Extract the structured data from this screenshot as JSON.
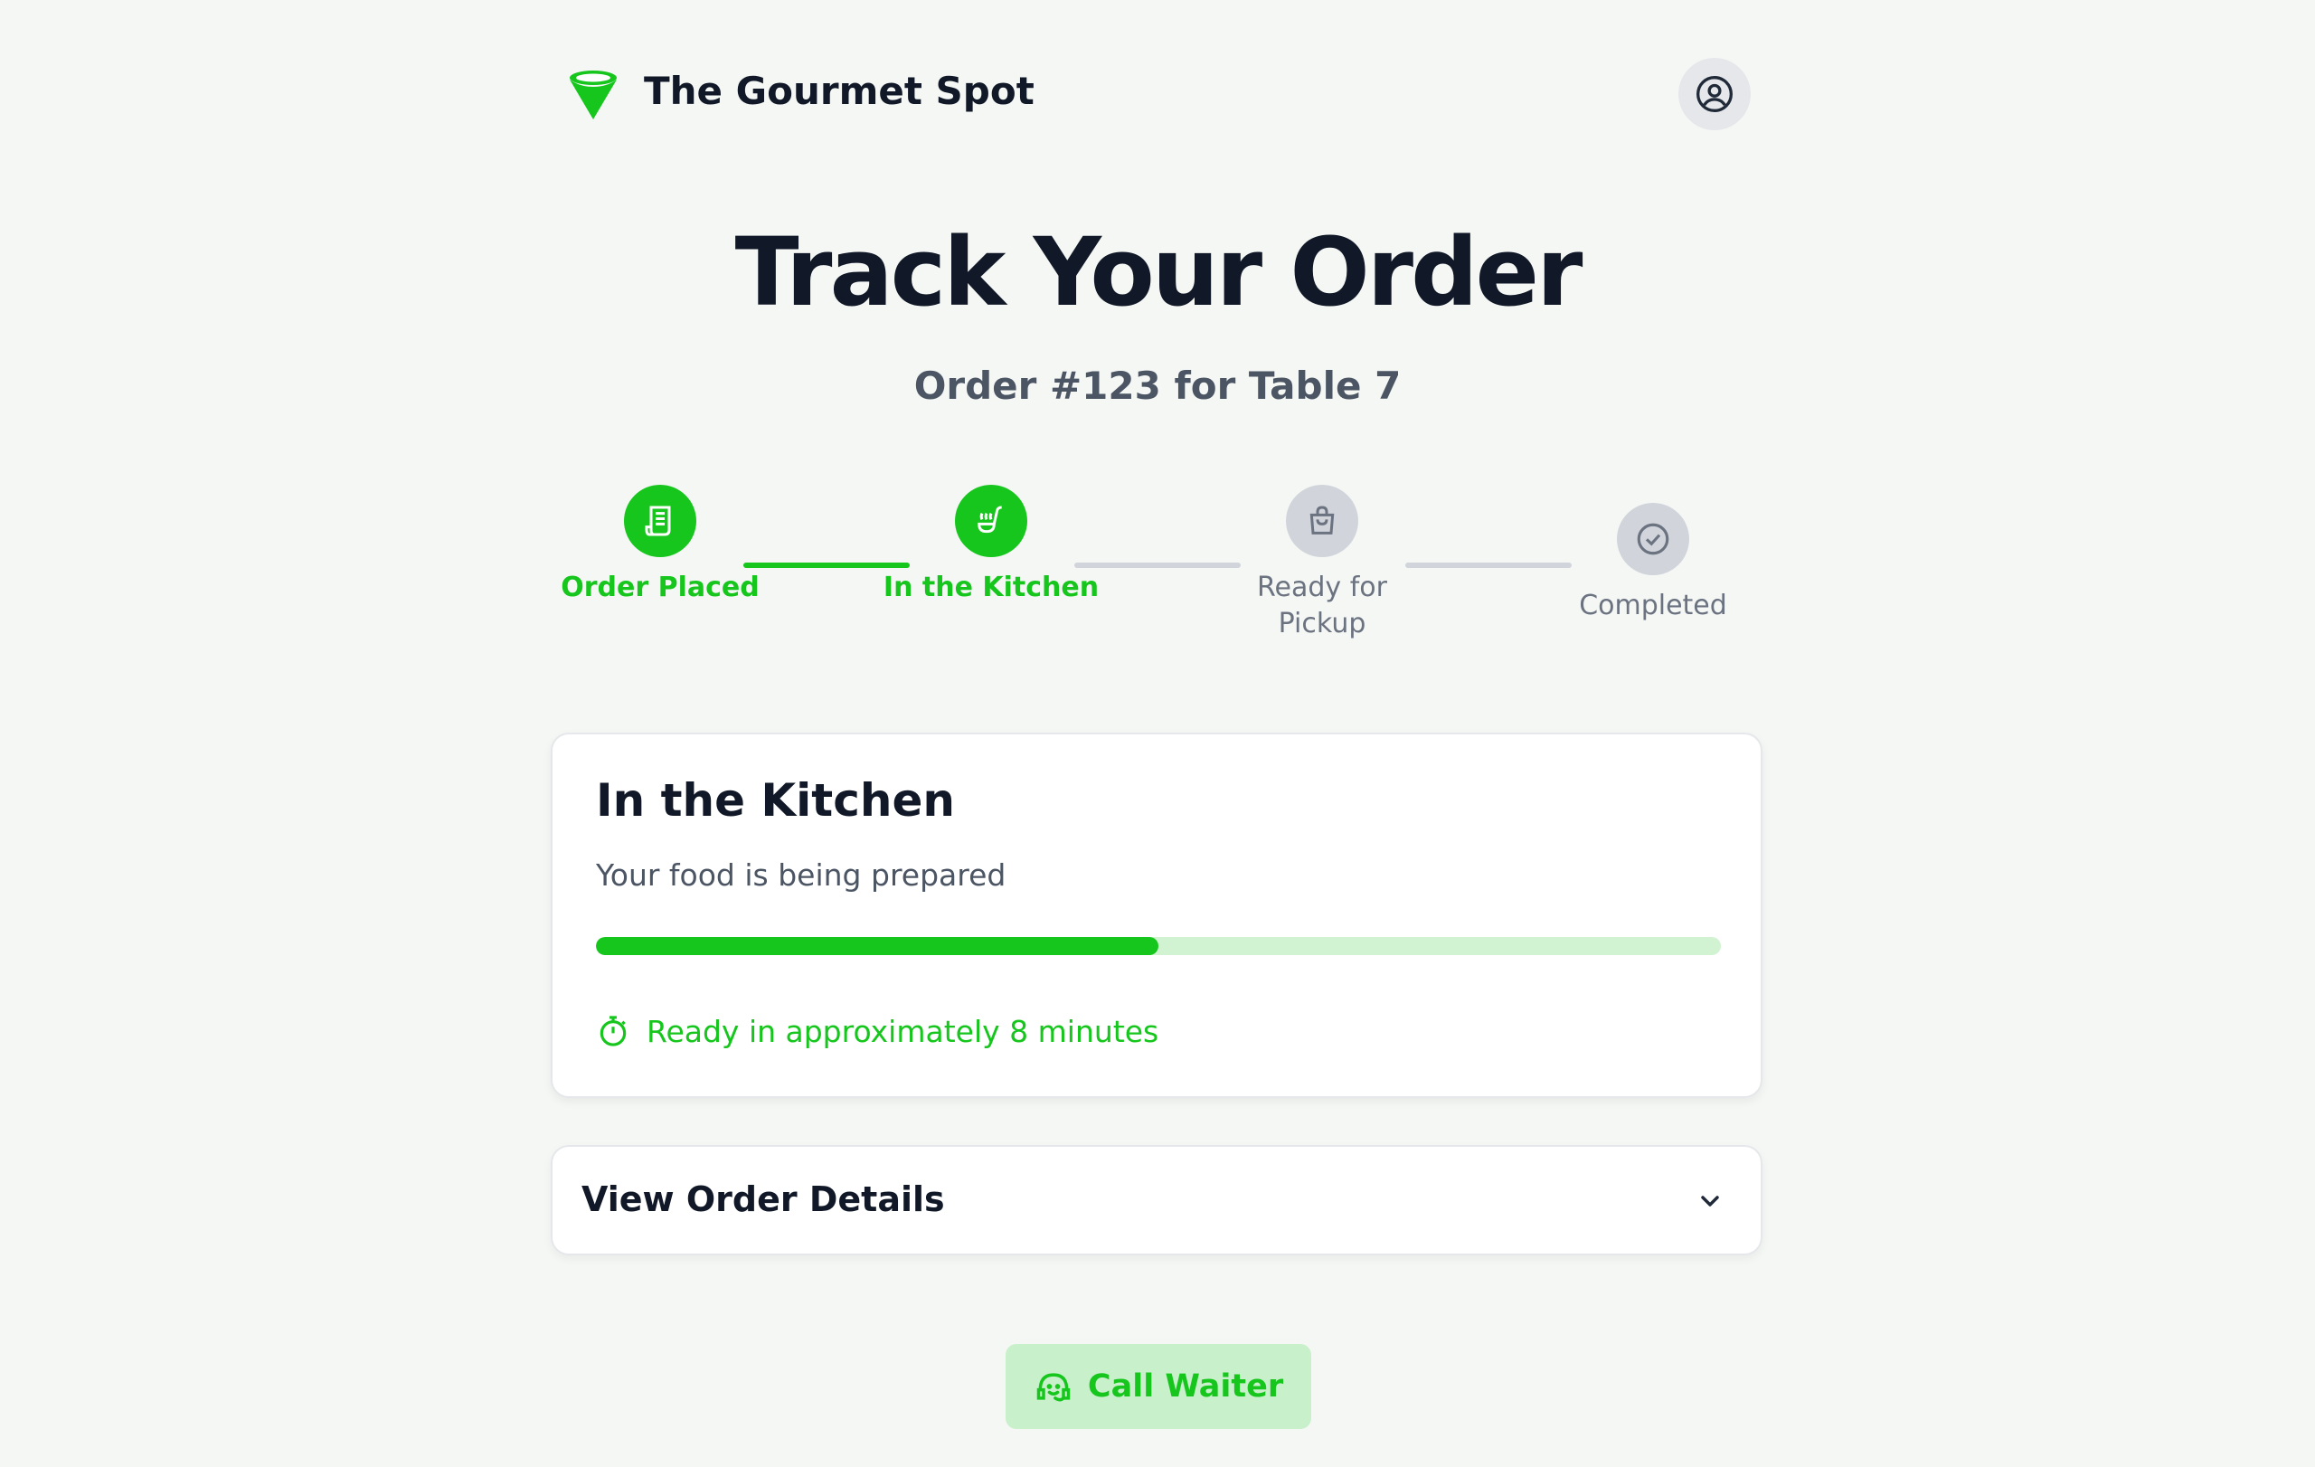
{
  "header": {
    "brand": "The Gourmet Spot",
    "logo_icon": "cone-logo-icon",
    "profile_icon": "user-circle-icon"
  },
  "page": {
    "title": "Track Your Order",
    "subtitle": "Order #123 for Table 7"
  },
  "steps": [
    {
      "label": "Order Placed",
      "icon": "receipt-icon",
      "state": "done"
    },
    {
      "label": "In the Kitchen",
      "icon": "ladle-steam-icon",
      "state": "done"
    },
    {
      "label": "Ready for Pickup",
      "icon": "shopping-bag-icon",
      "state": "pending"
    },
    {
      "label": "Completed",
      "icon": "check-circle-icon",
      "state": "pending"
    }
  ],
  "status": {
    "title": "In the Kitchen",
    "description": "Your food is being prepared",
    "progress_percent": 50,
    "eta_text": "Ready in approximately 8 minutes",
    "eta_icon": "stopwatch-icon"
  },
  "details": {
    "title": "View Order Details",
    "chevron_icon": "chevron-down-icon"
  },
  "actions": {
    "call_waiter_label": "Call Waiter",
    "call_waiter_icon": "waiter-icon"
  },
  "colors": {
    "accent": "#16c61d",
    "accent_light": "#c8f0ca",
    "track_light": "#d1f3d2",
    "inactive": "#d1d5db",
    "text_dark": "#111827",
    "text_muted": "#4b5563",
    "background": "#f5f7f5"
  }
}
